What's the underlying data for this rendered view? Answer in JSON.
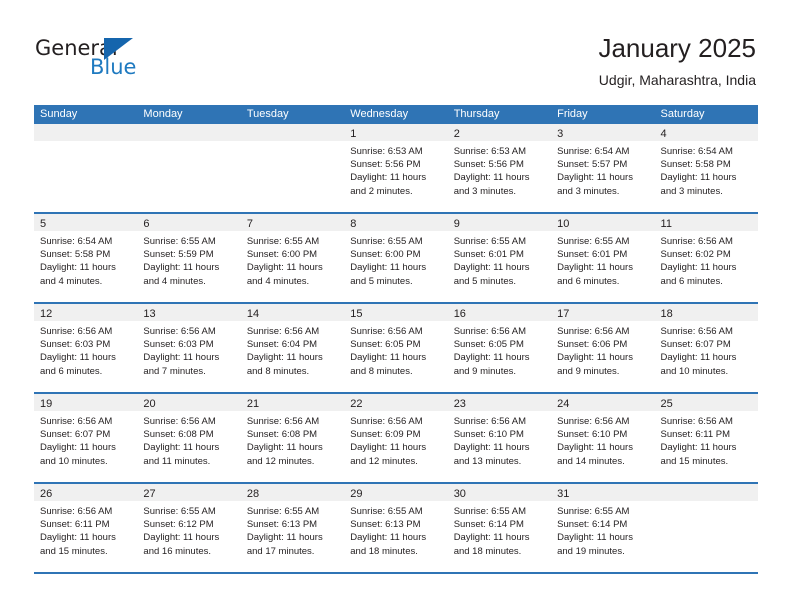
{
  "brand": {
    "name_part1": "General",
    "name_part2": "Blue",
    "flag_icon": "triangle-flag-icon",
    "accent_color": "#1565ad",
    "text_color": "#1f7ac0"
  },
  "header": {
    "title": "January 2025",
    "subtitle": "Udgir, Maharashtra, India"
  },
  "theme": {
    "header_blue": "#2f74b5",
    "band_gray": "#f0f0f0",
    "text": "#231f20"
  },
  "calendar": {
    "weekdays": [
      "Sunday",
      "Monday",
      "Tuesday",
      "Wednesday",
      "Thursday",
      "Friday",
      "Saturday"
    ],
    "weeks": [
      [
        {
          "day": "",
          "lines": []
        },
        {
          "day": "",
          "lines": []
        },
        {
          "day": "",
          "lines": []
        },
        {
          "day": "1",
          "lines": [
            "Sunrise: 6:53 AM",
            "Sunset: 5:56 PM",
            "Daylight: 11 hours",
            "and 2 minutes."
          ]
        },
        {
          "day": "2",
          "lines": [
            "Sunrise: 6:53 AM",
            "Sunset: 5:56 PM",
            "Daylight: 11 hours",
            "and 3 minutes."
          ]
        },
        {
          "day": "3",
          "lines": [
            "Sunrise: 6:54 AM",
            "Sunset: 5:57 PM",
            "Daylight: 11 hours",
            "and 3 minutes."
          ]
        },
        {
          "day": "4",
          "lines": [
            "Sunrise: 6:54 AM",
            "Sunset: 5:58 PM",
            "Daylight: 11 hours",
            "and 3 minutes."
          ]
        }
      ],
      [
        {
          "day": "5",
          "lines": [
            "Sunrise: 6:54 AM",
            "Sunset: 5:58 PM",
            "Daylight: 11 hours",
            "and 4 minutes."
          ]
        },
        {
          "day": "6",
          "lines": [
            "Sunrise: 6:55 AM",
            "Sunset: 5:59 PM",
            "Daylight: 11 hours",
            "and 4 minutes."
          ]
        },
        {
          "day": "7",
          "lines": [
            "Sunrise: 6:55 AM",
            "Sunset: 6:00 PM",
            "Daylight: 11 hours",
            "and 4 minutes."
          ]
        },
        {
          "day": "8",
          "lines": [
            "Sunrise: 6:55 AM",
            "Sunset: 6:00 PM",
            "Daylight: 11 hours",
            "and 5 minutes."
          ]
        },
        {
          "day": "9",
          "lines": [
            "Sunrise: 6:55 AM",
            "Sunset: 6:01 PM",
            "Daylight: 11 hours",
            "and 5 minutes."
          ]
        },
        {
          "day": "10",
          "lines": [
            "Sunrise: 6:55 AM",
            "Sunset: 6:01 PM",
            "Daylight: 11 hours",
            "and 6 minutes."
          ]
        },
        {
          "day": "11",
          "lines": [
            "Sunrise: 6:56 AM",
            "Sunset: 6:02 PM",
            "Daylight: 11 hours",
            "and 6 minutes."
          ]
        }
      ],
      [
        {
          "day": "12",
          "lines": [
            "Sunrise: 6:56 AM",
            "Sunset: 6:03 PM",
            "Daylight: 11 hours",
            "and 6 minutes."
          ]
        },
        {
          "day": "13",
          "lines": [
            "Sunrise: 6:56 AM",
            "Sunset: 6:03 PM",
            "Daylight: 11 hours",
            "and 7 minutes."
          ]
        },
        {
          "day": "14",
          "lines": [
            "Sunrise: 6:56 AM",
            "Sunset: 6:04 PM",
            "Daylight: 11 hours",
            "and 8 minutes."
          ]
        },
        {
          "day": "15",
          "lines": [
            "Sunrise: 6:56 AM",
            "Sunset: 6:05 PM",
            "Daylight: 11 hours",
            "and 8 minutes."
          ]
        },
        {
          "day": "16",
          "lines": [
            "Sunrise: 6:56 AM",
            "Sunset: 6:05 PM",
            "Daylight: 11 hours",
            "and 9 minutes."
          ]
        },
        {
          "day": "17",
          "lines": [
            "Sunrise: 6:56 AM",
            "Sunset: 6:06 PM",
            "Daylight: 11 hours",
            "and 9 minutes."
          ]
        },
        {
          "day": "18",
          "lines": [
            "Sunrise: 6:56 AM",
            "Sunset: 6:07 PM",
            "Daylight: 11 hours",
            "and 10 minutes."
          ]
        }
      ],
      [
        {
          "day": "19",
          "lines": [
            "Sunrise: 6:56 AM",
            "Sunset: 6:07 PM",
            "Daylight: 11 hours",
            "and 10 minutes."
          ]
        },
        {
          "day": "20",
          "lines": [
            "Sunrise: 6:56 AM",
            "Sunset: 6:08 PM",
            "Daylight: 11 hours",
            "and 11 minutes."
          ]
        },
        {
          "day": "21",
          "lines": [
            "Sunrise: 6:56 AM",
            "Sunset: 6:08 PM",
            "Daylight: 11 hours",
            "and 12 minutes."
          ]
        },
        {
          "day": "22",
          "lines": [
            "Sunrise: 6:56 AM",
            "Sunset: 6:09 PM",
            "Daylight: 11 hours",
            "and 12 minutes."
          ]
        },
        {
          "day": "23",
          "lines": [
            "Sunrise: 6:56 AM",
            "Sunset: 6:10 PM",
            "Daylight: 11 hours",
            "and 13 minutes."
          ]
        },
        {
          "day": "24",
          "lines": [
            "Sunrise: 6:56 AM",
            "Sunset: 6:10 PM",
            "Daylight: 11 hours",
            "and 14 minutes."
          ]
        },
        {
          "day": "25",
          "lines": [
            "Sunrise: 6:56 AM",
            "Sunset: 6:11 PM",
            "Daylight: 11 hours",
            "and 15 minutes."
          ]
        }
      ],
      [
        {
          "day": "26",
          "lines": [
            "Sunrise: 6:56 AM",
            "Sunset: 6:11 PM",
            "Daylight: 11 hours",
            "and 15 minutes."
          ]
        },
        {
          "day": "27",
          "lines": [
            "Sunrise: 6:55 AM",
            "Sunset: 6:12 PM",
            "Daylight: 11 hours",
            "and 16 minutes."
          ]
        },
        {
          "day": "28",
          "lines": [
            "Sunrise: 6:55 AM",
            "Sunset: 6:13 PM",
            "Daylight: 11 hours",
            "and 17 minutes."
          ]
        },
        {
          "day": "29",
          "lines": [
            "Sunrise: 6:55 AM",
            "Sunset: 6:13 PM",
            "Daylight: 11 hours",
            "and 18 minutes."
          ]
        },
        {
          "day": "30",
          "lines": [
            "Sunrise: 6:55 AM",
            "Sunset: 6:14 PM",
            "Daylight: 11 hours",
            "and 18 minutes."
          ]
        },
        {
          "day": "31",
          "lines": [
            "Sunrise: 6:55 AM",
            "Sunset: 6:14 PM",
            "Daylight: 11 hours",
            "and 19 minutes."
          ]
        },
        {
          "day": "",
          "lines": []
        }
      ]
    ]
  }
}
